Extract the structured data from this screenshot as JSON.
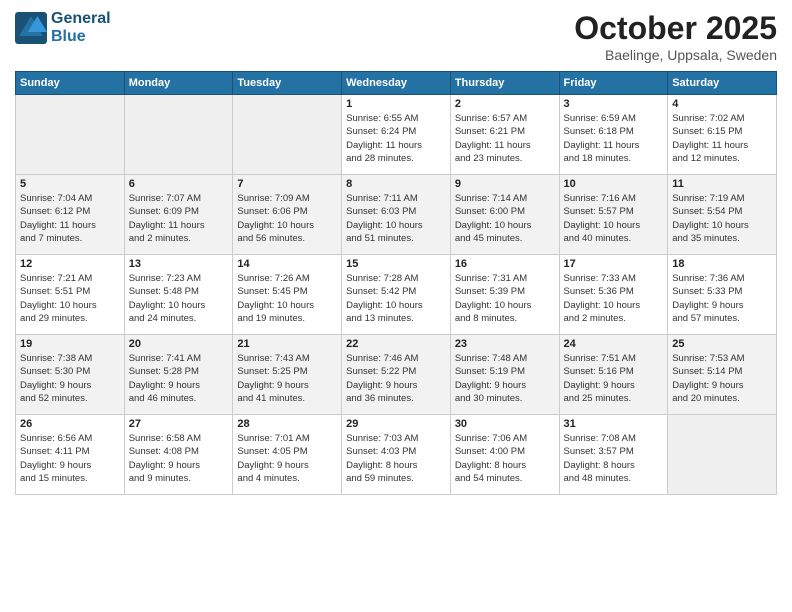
{
  "header": {
    "logo_line1": "General",
    "logo_line2": "Blue",
    "month": "October 2025",
    "location": "Baelinge, Uppsala, Sweden"
  },
  "weekdays": [
    "Sunday",
    "Monday",
    "Tuesday",
    "Wednesday",
    "Thursday",
    "Friday",
    "Saturday"
  ],
  "weeks": [
    [
      {
        "day": "",
        "info": ""
      },
      {
        "day": "",
        "info": ""
      },
      {
        "day": "",
        "info": ""
      },
      {
        "day": "1",
        "info": "Sunrise: 6:55 AM\nSunset: 6:24 PM\nDaylight: 11 hours\nand 28 minutes."
      },
      {
        "day": "2",
        "info": "Sunrise: 6:57 AM\nSunset: 6:21 PM\nDaylight: 11 hours\nand 23 minutes."
      },
      {
        "day": "3",
        "info": "Sunrise: 6:59 AM\nSunset: 6:18 PM\nDaylight: 11 hours\nand 18 minutes."
      },
      {
        "day": "4",
        "info": "Sunrise: 7:02 AM\nSunset: 6:15 PM\nDaylight: 11 hours\nand 12 minutes."
      }
    ],
    [
      {
        "day": "5",
        "info": "Sunrise: 7:04 AM\nSunset: 6:12 PM\nDaylight: 11 hours\nand 7 minutes."
      },
      {
        "day": "6",
        "info": "Sunrise: 7:07 AM\nSunset: 6:09 PM\nDaylight: 11 hours\nand 2 minutes."
      },
      {
        "day": "7",
        "info": "Sunrise: 7:09 AM\nSunset: 6:06 PM\nDaylight: 10 hours\nand 56 minutes."
      },
      {
        "day": "8",
        "info": "Sunrise: 7:11 AM\nSunset: 6:03 PM\nDaylight: 10 hours\nand 51 minutes."
      },
      {
        "day": "9",
        "info": "Sunrise: 7:14 AM\nSunset: 6:00 PM\nDaylight: 10 hours\nand 45 minutes."
      },
      {
        "day": "10",
        "info": "Sunrise: 7:16 AM\nSunset: 5:57 PM\nDaylight: 10 hours\nand 40 minutes."
      },
      {
        "day": "11",
        "info": "Sunrise: 7:19 AM\nSunset: 5:54 PM\nDaylight: 10 hours\nand 35 minutes."
      }
    ],
    [
      {
        "day": "12",
        "info": "Sunrise: 7:21 AM\nSunset: 5:51 PM\nDaylight: 10 hours\nand 29 minutes."
      },
      {
        "day": "13",
        "info": "Sunrise: 7:23 AM\nSunset: 5:48 PM\nDaylight: 10 hours\nand 24 minutes."
      },
      {
        "day": "14",
        "info": "Sunrise: 7:26 AM\nSunset: 5:45 PM\nDaylight: 10 hours\nand 19 minutes."
      },
      {
        "day": "15",
        "info": "Sunrise: 7:28 AM\nSunset: 5:42 PM\nDaylight: 10 hours\nand 13 minutes."
      },
      {
        "day": "16",
        "info": "Sunrise: 7:31 AM\nSunset: 5:39 PM\nDaylight: 10 hours\nand 8 minutes."
      },
      {
        "day": "17",
        "info": "Sunrise: 7:33 AM\nSunset: 5:36 PM\nDaylight: 10 hours\nand 2 minutes."
      },
      {
        "day": "18",
        "info": "Sunrise: 7:36 AM\nSunset: 5:33 PM\nDaylight: 9 hours\nand 57 minutes."
      }
    ],
    [
      {
        "day": "19",
        "info": "Sunrise: 7:38 AM\nSunset: 5:30 PM\nDaylight: 9 hours\nand 52 minutes."
      },
      {
        "day": "20",
        "info": "Sunrise: 7:41 AM\nSunset: 5:28 PM\nDaylight: 9 hours\nand 46 minutes."
      },
      {
        "day": "21",
        "info": "Sunrise: 7:43 AM\nSunset: 5:25 PM\nDaylight: 9 hours\nand 41 minutes."
      },
      {
        "day": "22",
        "info": "Sunrise: 7:46 AM\nSunset: 5:22 PM\nDaylight: 9 hours\nand 36 minutes."
      },
      {
        "day": "23",
        "info": "Sunrise: 7:48 AM\nSunset: 5:19 PM\nDaylight: 9 hours\nand 30 minutes."
      },
      {
        "day": "24",
        "info": "Sunrise: 7:51 AM\nSunset: 5:16 PM\nDaylight: 9 hours\nand 25 minutes."
      },
      {
        "day": "25",
        "info": "Sunrise: 7:53 AM\nSunset: 5:14 PM\nDaylight: 9 hours\nand 20 minutes."
      }
    ],
    [
      {
        "day": "26",
        "info": "Sunrise: 6:56 AM\nSunset: 4:11 PM\nDaylight: 9 hours\nand 15 minutes."
      },
      {
        "day": "27",
        "info": "Sunrise: 6:58 AM\nSunset: 4:08 PM\nDaylight: 9 hours\nand 9 minutes."
      },
      {
        "day": "28",
        "info": "Sunrise: 7:01 AM\nSunset: 4:05 PM\nDaylight: 9 hours\nand 4 minutes."
      },
      {
        "day": "29",
        "info": "Sunrise: 7:03 AM\nSunset: 4:03 PM\nDaylight: 8 hours\nand 59 minutes."
      },
      {
        "day": "30",
        "info": "Sunrise: 7:06 AM\nSunset: 4:00 PM\nDaylight: 8 hours\nand 54 minutes."
      },
      {
        "day": "31",
        "info": "Sunrise: 7:08 AM\nSunset: 3:57 PM\nDaylight: 8 hours\nand 48 minutes."
      },
      {
        "day": "",
        "info": ""
      }
    ]
  ]
}
